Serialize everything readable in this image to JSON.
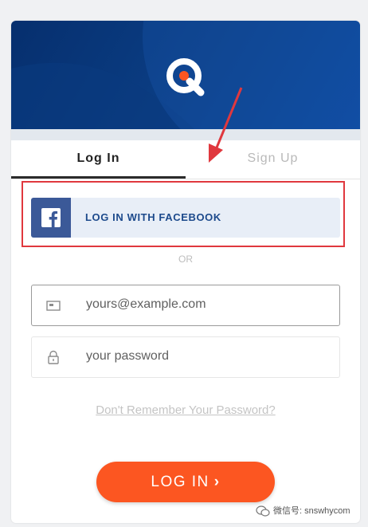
{
  "colors": {
    "header": "#0b3f86",
    "facebook": "#3b5998",
    "accent_orange": "#fc5621",
    "annotation_red": "#e0383e"
  },
  "tabs": [
    {
      "label": "Log In",
      "active": true
    },
    {
      "label": "Sign Up",
      "active": false
    }
  ],
  "facebook": {
    "label": "LOG IN WITH FACEBOOK",
    "icon": "facebook-icon"
  },
  "divider": {
    "label": "OR"
  },
  "email": {
    "placeholder": "yours@example.com",
    "value": "",
    "icon": "envelope-icon"
  },
  "password": {
    "placeholder": "your password",
    "value": "",
    "icon": "lock-icon"
  },
  "forgot": {
    "label": "Don't Remember Your Password?"
  },
  "submit": {
    "label": "LOG IN",
    "icon": "chevron-right-icon"
  },
  "watermark": {
    "text": "微信号: snswhycom"
  }
}
